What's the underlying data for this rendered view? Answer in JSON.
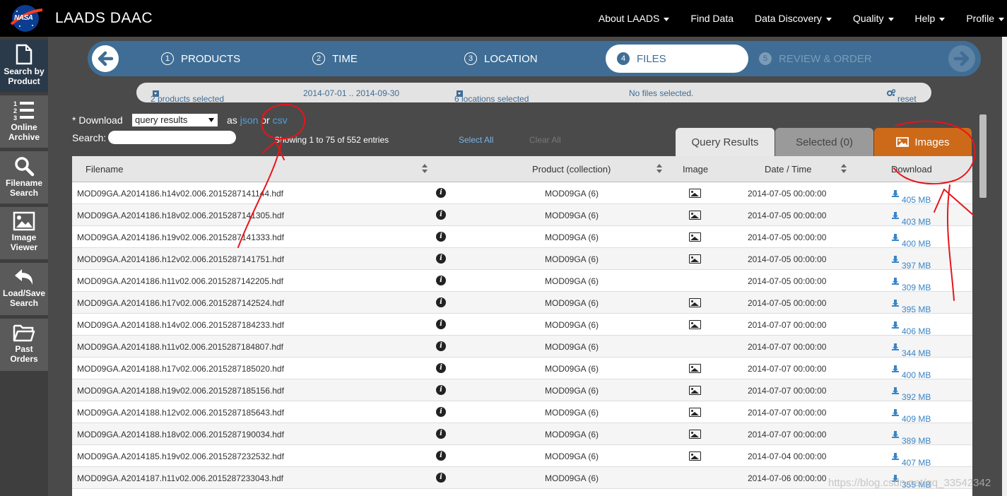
{
  "topbar": {
    "logo_text": "NASA",
    "brand": "LAADS DAAC",
    "nav": [
      {
        "label": "About LAADS",
        "has_caret": true
      },
      {
        "label": "Find Data",
        "has_caret": false
      },
      {
        "label": "Data Discovery",
        "has_caret": true
      },
      {
        "label": "Quality",
        "has_caret": true
      },
      {
        "label": "Help",
        "has_caret": true
      },
      {
        "label": "Profile",
        "has_caret": true
      }
    ]
  },
  "sidebar": {
    "items": [
      {
        "label_1": "Search by",
        "label_2": "Product",
        "icon": "file-icon"
      },
      {
        "label_1": "Online",
        "label_2": "Archive",
        "icon": "numbered-list-icon"
      },
      {
        "label_1": "Filename",
        "label_2": "Search",
        "icon": "search-icon"
      },
      {
        "label_1": "Image",
        "label_2": "Viewer",
        "icon": "image-icon"
      },
      {
        "label_1": "Load/Save",
        "label_2": "Search",
        "icon": "undo-arrow-icon"
      },
      {
        "label_1": "Past Orders",
        "label_2": "",
        "icon": "folder-icon"
      }
    ]
  },
  "wizard": {
    "steps": [
      {
        "num": "1",
        "label": "PRODUCTS"
      },
      {
        "num": "2",
        "label": "TIME"
      },
      {
        "num": "3",
        "label": "LOCATION"
      },
      {
        "num": "4",
        "label": "FILES"
      },
      {
        "num": "5",
        "label": "REVIEW & ORDER"
      }
    ]
  },
  "summary": {
    "products": "2 products selected",
    "dates": "2014-07-01 .. 2014-09-30",
    "locations": "6 locations selected",
    "files": "No files selected.",
    "reset": "reset"
  },
  "controls": {
    "download_label": "* Download",
    "download_select": "query results",
    "as_label": "as",
    "json_link": "json",
    "or_label": "or",
    "csv_link": "csv",
    "search_label": "Search:",
    "showing": "Showing 1 to 75 of 552 entries",
    "select_all": "Select All",
    "clear_all": "Clear All"
  },
  "tabs": {
    "query_results": "Query Results",
    "selected": "Selected (0)",
    "images": "Images"
  },
  "table": {
    "headers": [
      "Filename",
      "Product (collection)",
      "Image",
      "Date / Time",
      "Download"
    ],
    "rows": [
      {
        "filename": "MOD09GA.A2014186.h14v02.006.2015287141144.hdf",
        "product": "MOD09GA (6)",
        "has_image": true,
        "datetime": "2014-07-05 00:00:00",
        "size": "405 MB"
      },
      {
        "filename": "MOD09GA.A2014186.h18v02.006.2015287141305.hdf",
        "product": "MOD09GA (6)",
        "has_image": true,
        "datetime": "2014-07-05 00:00:00",
        "size": "403 MB"
      },
      {
        "filename": "MOD09GA.A2014186.h19v02.006.2015287141333.hdf",
        "product": "MOD09GA (6)",
        "has_image": true,
        "datetime": "2014-07-05 00:00:00",
        "size": "400 MB"
      },
      {
        "filename": "MOD09GA.A2014186.h12v02.006.2015287141751.hdf",
        "product": "MOD09GA (6)",
        "has_image": true,
        "datetime": "2014-07-05 00:00:00",
        "size": "397 MB"
      },
      {
        "filename": "MOD09GA.A2014186.h11v02.006.2015287142205.hdf",
        "product": "MOD09GA (6)",
        "has_image": false,
        "datetime": "2014-07-05 00:00:00",
        "size": "309 MB"
      },
      {
        "filename": "MOD09GA.A2014186.h17v02.006.2015287142524.hdf",
        "product": "MOD09GA (6)",
        "has_image": true,
        "datetime": "2014-07-05 00:00:00",
        "size": "395 MB"
      },
      {
        "filename": "MOD09GA.A2014188.h14v02.006.2015287184233.hdf",
        "product": "MOD09GA (6)",
        "has_image": true,
        "datetime": "2014-07-07 00:00:00",
        "size": "406 MB"
      },
      {
        "filename": "MOD09GA.A2014188.h11v02.006.2015287184807.hdf",
        "product": "MOD09GA (6)",
        "has_image": false,
        "datetime": "2014-07-07 00:00:00",
        "size": "344 MB"
      },
      {
        "filename": "MOD09GA.A2014188.h17v02.006.2015287185020.hdf",
        "product": "MOD09GA (6)",
        "has_image": true,
        "datetime": "2014-07-07 00:00:00",
        "size": "400 MB"
      },
      {
        "filename": "MOD09GA.A2014188.h19v02.006.2015287185156.hdf",
        "product": "MOD09GA (6)",
        "has_image": true,
        "datetime": "2014-07-07 00:00:00",
        "size": "392 MB"
      },
      {
        "filename": "MOD09GA.A2014188.h12v02.006.2015287185643.hdf",
        "product": "MOD09GA (6)",
        "has_image": true,
        "datetime": "2014-07-07 00:00:00",
        "size": "409 MB"
      },
      {
        "filename": "MOD09GA.A2014188.h18v02.006.2015287190034.hdf",
        "product": "MOD09GA (6)",
        "has_image": true,
        "datetime": "2014-07-07 00:00:00",
        "size": "389 MB"
      },
      {
        "filename": "MOD09GA.A2014185.h19v02.006.2015287232532.hdf",
        "product": "MOD09GA (6)",
        "has_image": true,
        "datetime": "2014-07-04 00:00:00",
        "size": "407 MB"
      },
      {
        "filename": "MOD09GA.A2014187.h11v02.006.2015287233043.hdf",
        "product": "MOD09GA (6)",
        "has_image": false,
        "datetime": "2014-07-06 00:00:00",
        "size": "355 MB"
      }
    ]
  },
  "watermark": "https://blog.csdn.net/qq_33542342",
  "colors": {
    "nav_bg": "#000000",
    "wizard_bg": "#3f6d95",
    "images_tab": "#cc6a1a",
    "link": "#3a85c6",
    "annotation": "#e8141a"
  }
}
